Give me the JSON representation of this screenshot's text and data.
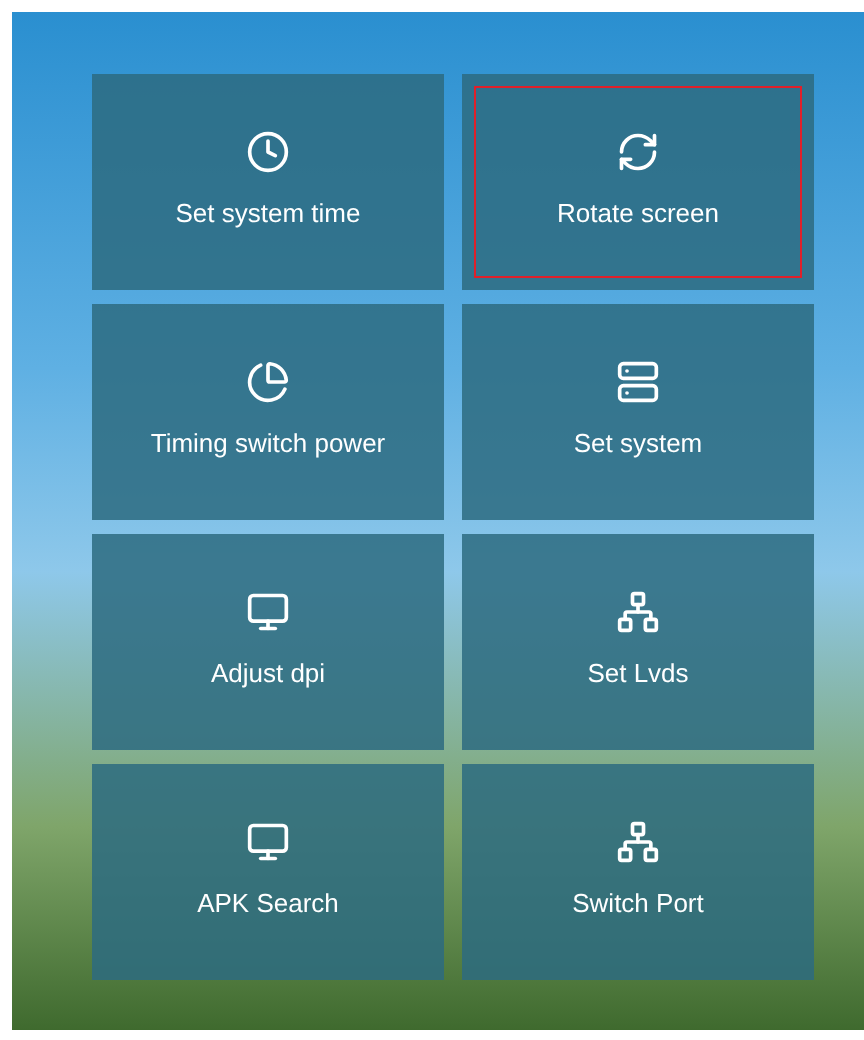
{
  "tiles": [
    {
      "label": "Set system time",
      "selected": false
    },
    {
      "label": "Rotate screen",
      "selected": true
    },
    {
      "label": "Timing switch power",
      "selected": false
    },
    {
      "label": "Set system",
      "selected": false
    },
    {
      "label": "Adjust dpi",
      "selected": false
    },
    {
      "label": "Set Lvds",
      "selected": false
    },
    {
      "label": "APK Search",
      "selected": false
    },
    {
      "label": "Switch Port",
      "selected": false
    }
  ]
}
